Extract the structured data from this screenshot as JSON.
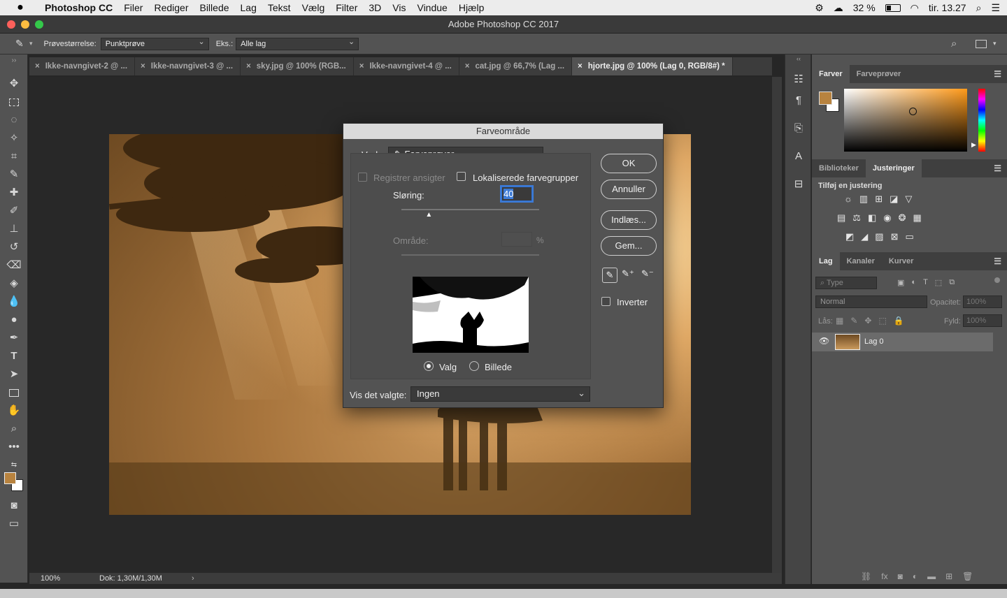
{
  "menubar": {
    "app": "Photoshop CC",
    "items": [
      "Filer",
      "Rediger",
      "Billede",
      "Lag",
      "Tekst",
      "Vælg",
      "Filter",
      "3D",
      "Vis",
      "Vindue",
      "Hjælp"
    ],
    "battery": "32 %",
    "clock": "tir. 13.27"
  },
  "window": {
    "title": "Adobe Photoshop CC 2017"
  },
  "options": {
    "sample_size_label": "Prøvestørrelse:",
    "sample_size_value": "Punktprøve",
    "sample_label": "Eks.:",
    "sample_value": "Alle lag"
  },
  "tabs": [
    {
      "label": "Ikke-navngivet-2 @ ...",
      "active": false
    },
    {
      "label": "Ikke-navngivet-3 @ ...",
      "active": false
    },
    {
      "label": "sky.jpg @ 100% (RGB...",
      "active": false
    },
    {
      "label": "Ikke-navngivet-4 @ ...",
      "active": false
    },
    {
      "label": "cat.jpg @ 66,7% (Lag ...",
      "active": false
    },
    {
      "label": "hjorte.jpg @ 100% (Lag 0, RGB/8#) *",
      "active": true
    }
  ],
  "status": {
    "zoom": "100%",
    "doc": "Dok: 1,30M/1,30M"
  },
  "dialog": {
    "title": "Farveområde",
    "select_label": "Vælg:",
    "select_value": "Farveprøver",
    "detect_faces": "Registrer ansigter",
    "localized": "Lokaliserede farvegrupper",
    "fuzziness_label": "Sløring:",
    "fuzziness_value": "40",
    "fuzziness_fraction": 0.2,
    "range_label": "Område:",
    "range_unit": "%",
    "radio_selection": "Valg",
    "radio_image": "Billede",
    "preview_label": "Vis det valgte:",
    "preview_value": "Ingen",
    "ok": "OK",
    "cancel": "Annuller",
    "load": "Indlæs...",
    "save": "Gem...",
    "invert": "Inverter"
  },
  "colors_panel": {
    "tab_colors": "Farver",
    "tab_swatches": "Farveprøver",
    "foreground": "#b8833f",
    "background": "#ffffff"
  },
  "adjust_panel": {
    "tab_libraries": "Biblioteker",
    "tab_adjustments": "Justeringer",
    "heading": "Tilføj en justering"
  },
  "layers_panel": {
    "tab_layers": "Lag",
    "tab_channels": "Kanaler",
    "tab_curves": "Kurver",
    "filter_placeholder": "Type",
    "blend_mode": "Normal",
    "opacity_label": "Opacitet:",
    "opacity_value": "100%",
    "lock_label": "Lås:",
    "fill_label": "Fyld:",
    "fill_value": "100%",
    "layer_name": "Lag 0"
  }
}
